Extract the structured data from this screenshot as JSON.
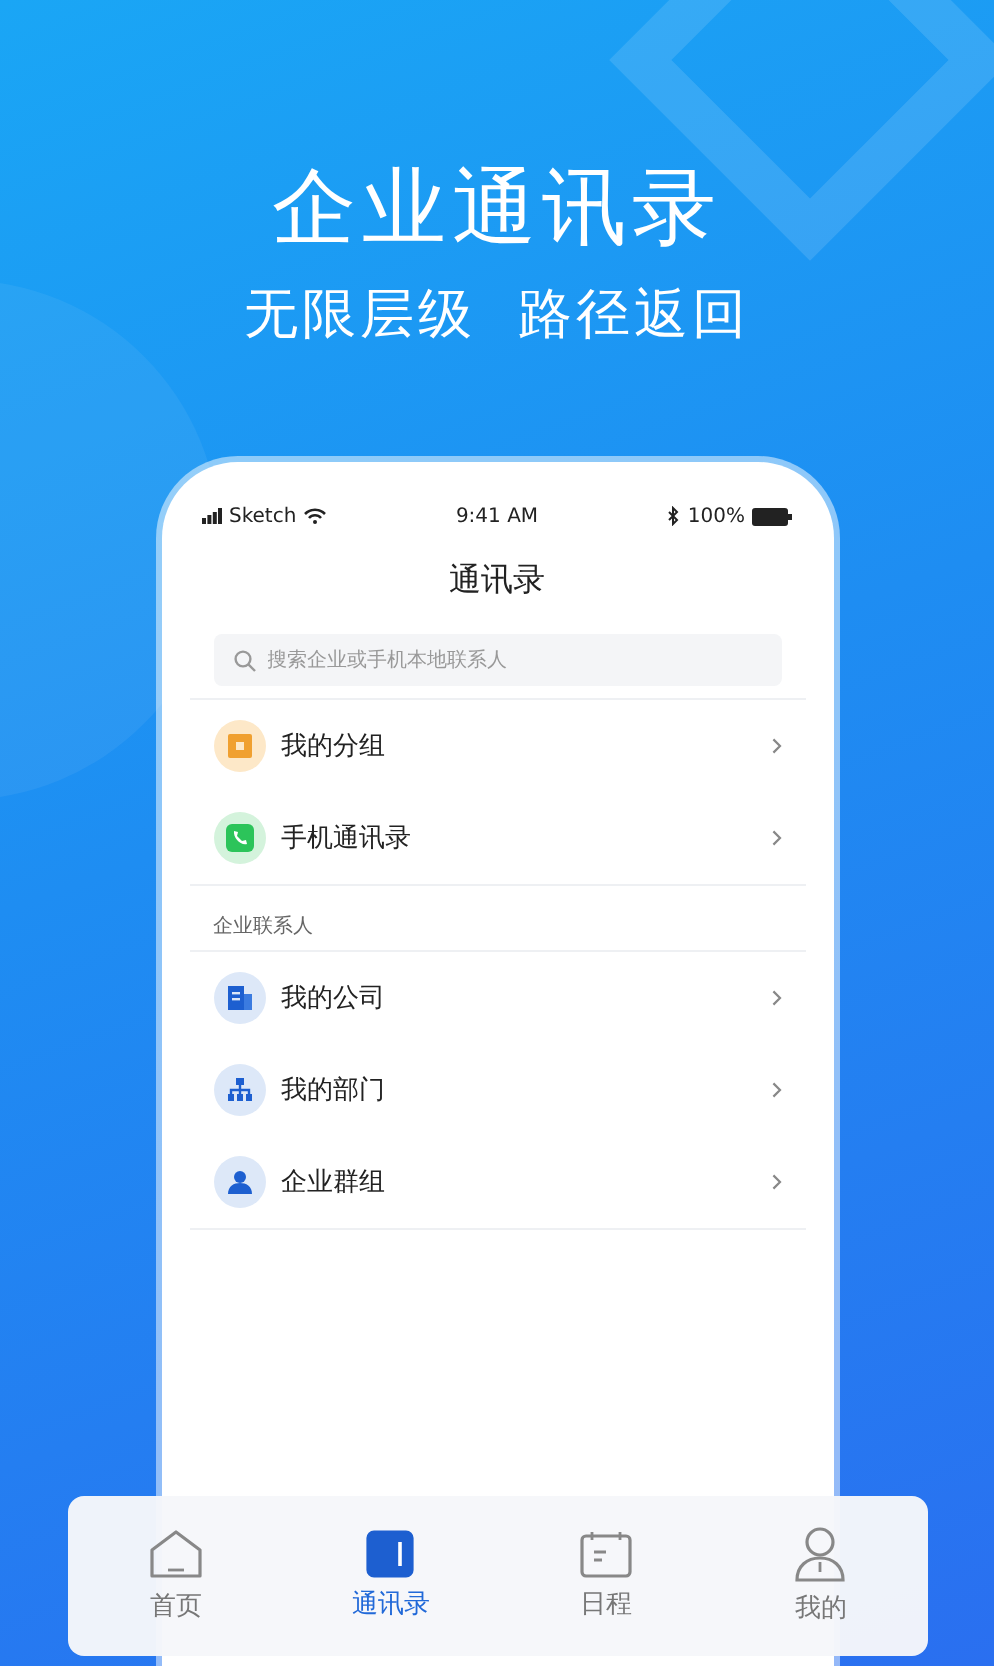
{
  "hero": {
    "title": "企业通讯录",
    "subtitle": "无限层级  路径返回"
  },
  "status_bar": {
    "carrier": "Sketch",
    "time": "9:41 AM",
    "battery": "100%"
  },
  "screen_title": "通讯录",
  "search": {
    "placeholder": "搜索企业或手机本地联系人"
  },
  "sections": [
    {
      "items": [
        {
          "kind": "group",
          "label": "我的分组"
        },
        {
          "kind": "phone",
          "label": "手机通讯录"
        }
      ]
    },
    {
      "header": "企业联系人",
      "items": [
        {
          "kind": "company",
          "label": "我的公司"
        },
        {
          "kind": "department",
          "label": "我的部门"
        },
        {
          "kind": "team",
          "label": "企业群组"
        }
      ]
    }
  ],
  "tabs": [
    {
      "kind": "home",
      "label": "首页",
      "selected": false
    },
    {
      "kind": "contacts",
      "label": "通讯录",
      "selected": true
    },
    {
      "kind": "calendar",
      "label": "日程",
      "selected": false
    },
    {
      "kind": "profile",
      "label": "我的",
      "selected": false
    }
  ]
}
